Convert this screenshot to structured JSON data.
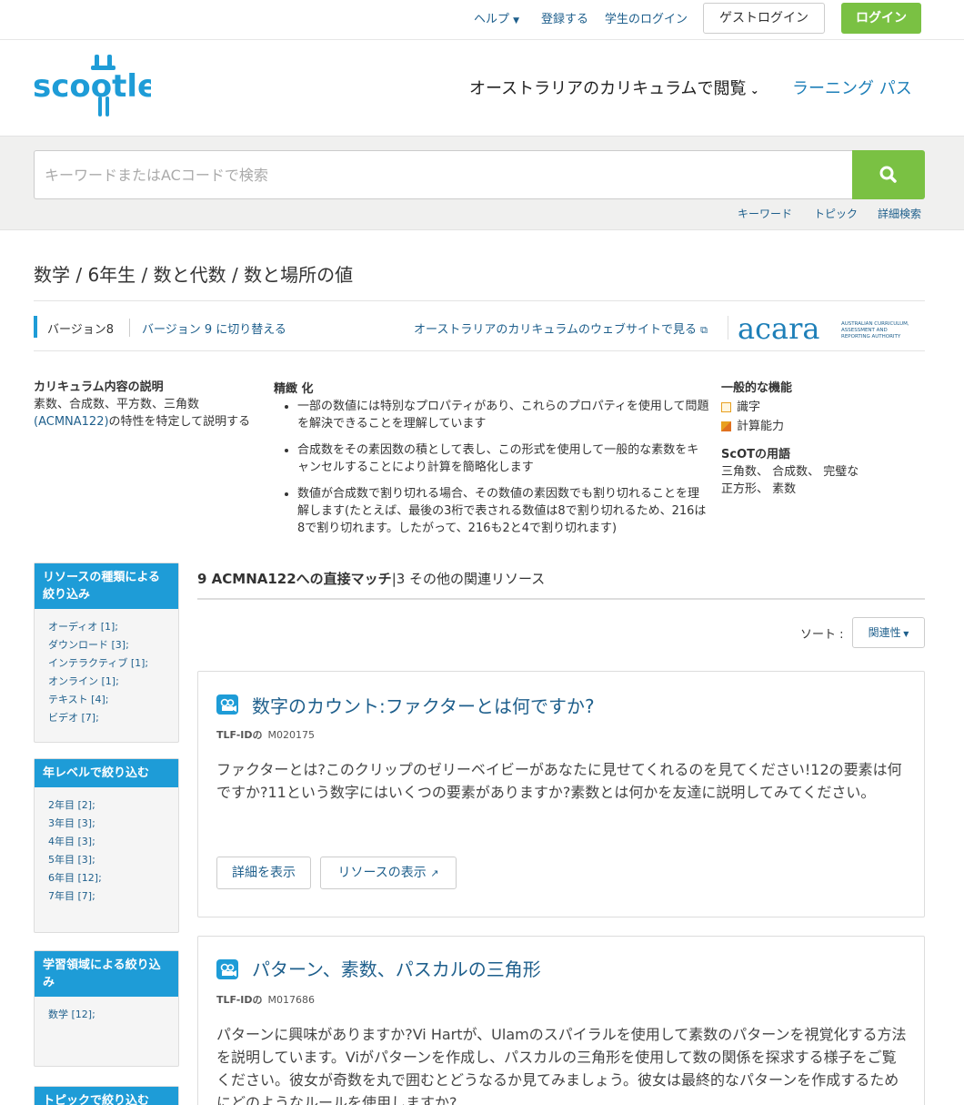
{
  "topbar": {
    "help": "ヘルプ",
    "register": "登録する",
    "student_login": "学生のログイン",
    "guest_login": "ゲストログイン",
    "login": "ログイン"
  },
  "header": {
    "logo_text": "scootle",
    "browse_ac": "オーストラリアのカリキュラムで閲覧",
    "learning_path": "ラーニング パス"
  },
  "search": {
    "placeholder": "キーワードまたはACコードで検索",
    "links": [
      "キーワード",
      "トピック",
      "詳細検索"
    ]
  },
  "breadcrumb": "数学 / 6年生 / 数と代数 / 数と場所の値",
  "version": {
    "current": "バージョン8",
    "switch": "バージョン 9 に切り替える",
    "ac_site": "オーストラリアのカリキュラムのウェブサイトで見る",
    "acara_logo": "acara",
    "acara_tag": [
      "AUSTRALIAN CURRICULUM,",
      "ASSESSMENT AND",
      "REPORTING AUTHORITY"
    ]
  },
  "content_description": {
    "heading": "カリキュラム内容の説明",
    "text1": "素数、合成数、平方数、三角数",
    "code": "(ACMNA122)",
    "text2": "の特性を特定して説明する"
  },
  "elaborations": {
    "heading": "精緻 化",
    "items": [
      "一部の数値には特別なプロパティがあり、これらのプロパティを使用して問題を解決できることを理解しています",
      "合成数をその素因数の積として表し、この形式を使用して一般的な素数をキャンセルすることにより計算を簡略化します",
      "数値が合成数で割り切れる場合、その数値の素因数でも割り切れることを理解します(たとえば、最後の3桁で表される数値は8で割り切れるため、216は8で割り切れます。したがって、216も2と4で割り切れます)"
    ]
  },
  "general_capabilities": {
    "heading": "一般的な機能",
    "items": [
      "識字",
      "計算能力"
    ],
    "colors": [
      "#e8a020",
      "#e07020"
    ]
  },
  "scot_terms": {
    "heading": "ScOTの用語",
    "line1": "三角数、 合成数、 完璧な",
    "line2": "正方形、 素数"
  },
  "sidebar": {
    "resource_type": {
      "heading": "リソースの種類による絞り込み",
      "items": [
        "オーディオ [1];",
        "ダウンロード [3];",
        "インテラクティブ [1];",
        "オンライン [1];",
        "テキスト [4];",
        "ビデオ [7];"
      ]
    },
    "year_level": {
      "heading": "年レベルで絞り込む",
      "items": [
        "2年目 [2];",
        "3年目 [3];",
        "4年目 [3];",
        "5年目 [3];",
        "6年目 [12];",
        "7年目 [7];"
      ]
    },
    "learning_area": {
      "heading": "学習領域による絞り込み",
      "items": [
        "数学 [12];"
      ]
    },
    "topic": {
      "heading": "トピックで絞り込む"
    }
  },
  "results": {
    "direct_count": "9 ACMNA122への直接マッチ",
    "other": "|3 その他の関連リソース",
    "sort_label": "ソート :",
    "sort_value": "関連性"
  },
  "cards": [
    {
      "title": "数字のカウント:ファクターとは何ですか?",
      "id_label": "TLF-IDの",
      "id": "M020175",
      "description": "ファクターとは?このクリップのゼリーベイビーがあなたに見せてくれるのを見てください!12の要素は何ですか?11という数字にはいくつの要素がありますか?素数とは何かを友達に説明してみてください。",
      "details_btn": "詳細を表示",
      "view_btn": "リソースの表示"
    },
    {
      "title": "パターン、素数、パスカルの三角形",
      "id_label": "TLF-IDの",
      "id": "M017686",
      "description": "パターンに興味がありますか?Vi Hartが、Ulamのスパイラルを使用して素数のパターンを視覚化する方法を説明しています。Viがパターンを作成し、パスカルの三角形を使用して数の関係を探求する様子をご覧ください。彼女が奇数を丸で囲むとどうなるか見てみましょう。彼女は最終的なパターンを作成するためにどのようなルールを使用しますか?"
    }
  ],
  "colors": {
    "accent_green": "#7ac143",
    "accent_blue": "#1e9cd7",
    "link_blue": "#1e5f8c"
  }
}
